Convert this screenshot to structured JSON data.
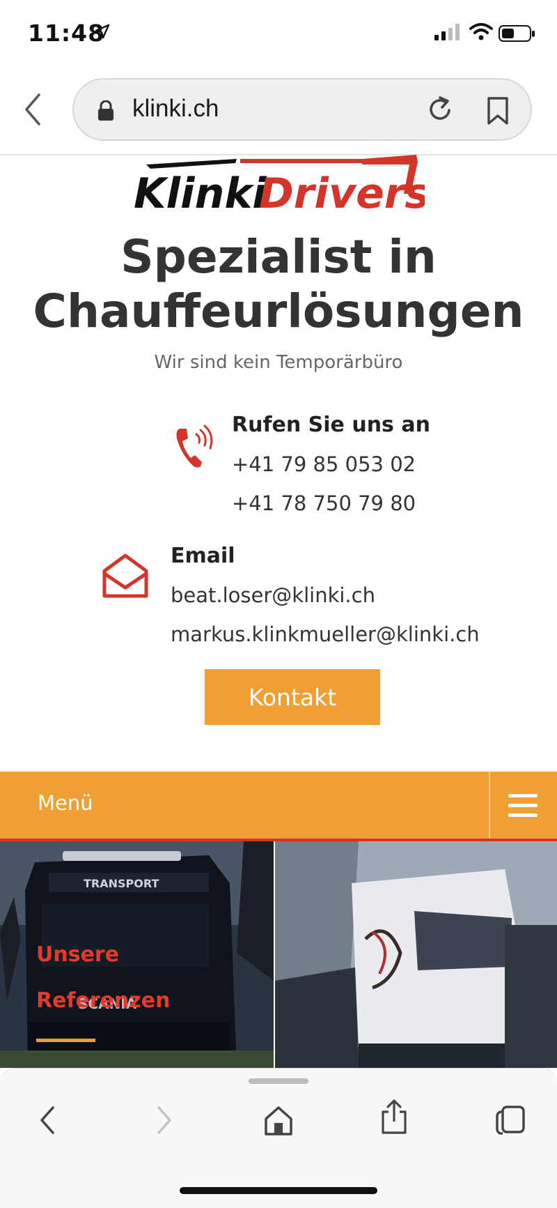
{
  "status_bar": {
    "time": "11:48"
  },
  "browser": {
    "url": "klinki.ch"
  },
  "logo": {
    "part1": "Klinki",
    "part2": "Drivers"
  },
  "hero": {
    "headline_line1": "Spezialist in",
    "headline_line2": "Chauffeurlösungen",
    "subline": "Wir sind kein Temporärbüro"
  },
  "phone": {
    "title": "Rufen Sie uns an",
    "numbers": [
      "+41 79 85 053 02",
      "+41 78 750 79 80"
    ]
  },
  "email": {
    "title": "Email",
    "addresses": [
      "beat.loser@klinki.ch",
      "markus.klinkmueller@klinki.ch"
    ]
  },
  "kontakt_button": "Kontakt",
  "menu": {
    "label": "Menü"
  },
  "references": {
    "line1": "Unsere",
    "line2": "Referenzen",
    "truck_brand": "SCANIA",
    "truck_sign": "TRANSPORT"
  },
  "colors": {
    "accent_orange": "#f09f33",
    "accent_red": "#d3352b",
    "text_dark": "#333333"
  },
  "icons": [
    "location-arrow-icon",
    "signal-icon",
    "wifi-icon",
    "battery-icon",
    "back-chevron-icon",
    "lock-icon",
    "reload-icon",
    "bookmark-icon",
    "phone-icon",
    "mail-icon",
    "hamburger-icon",
    "share-icon",
    "tabs-icon",
    "home-icon",
    "forward-chevron-icon"
  ]
}
